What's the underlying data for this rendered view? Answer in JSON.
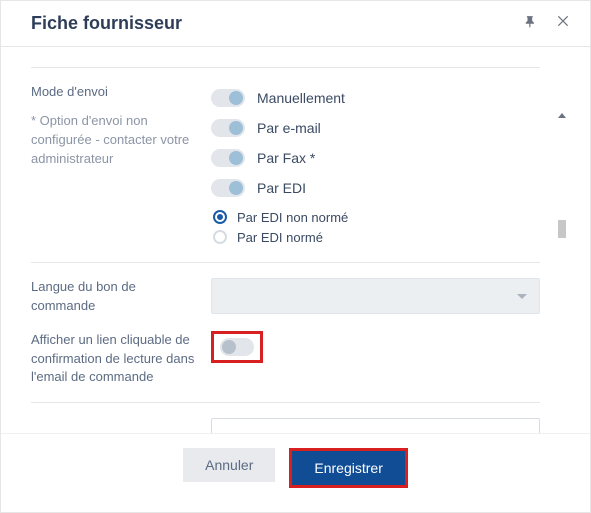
{
  "header": {
    "title": "Fiche fournisseur"
  },
  "send_mode": {
    "label": "Mode d'envoi",
    "note": "* Option d'envoi non configurée - contacter votre administrateur",
    "options": {
      "manual": "Manuellement",
      "email": "Par e-mail",
      "fax": "Par Fax *",
      "edi": "Par EDI"
    },
    "edi_radio": {
      "non_norme": "Par EDI non normé",
      "norme": "Par EDI normé"
    }
  },
  "lang": {
    "label": "Langue du bon de commande",
    "value": ""
  },
  "read_confirm": {
    "label": "Afficher un lien cliquable de confirmation de lecture dans l'email de commande"
  },
  "footer": {
    "cancel": "Annuler",
    "save": "Enregistrer"
  }
}
